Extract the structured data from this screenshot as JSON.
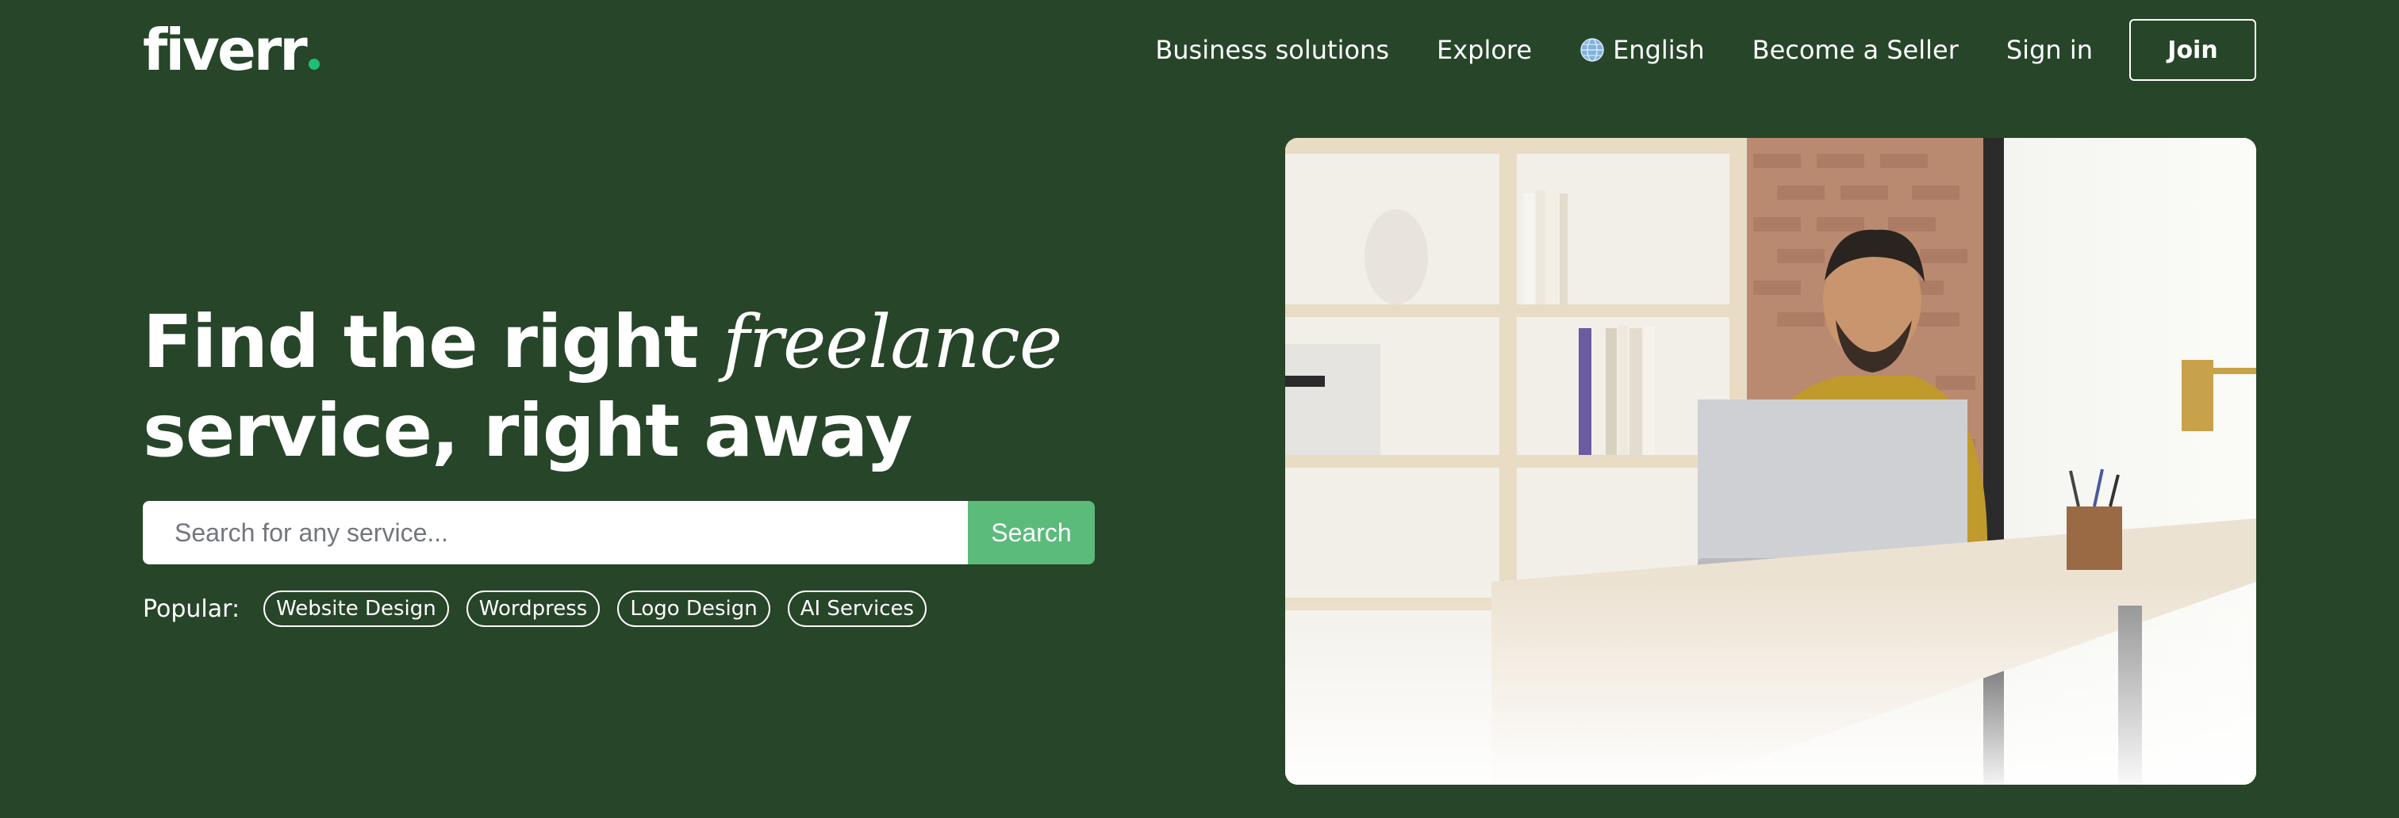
{
  "brand": {
    "logo_text": "fiverr",
    "accent": "#1dbf73",
    "background": "#274529"
  },
  "nav": {
    "items": [
      {
        "label": "Business solutions"
      },
      {
        "label": "Explore"
      },
      {
        "label": "English",
        "icon": "globe-icon"
      },
      {
        "label": "Become a Seller"
      },
      {
        "label": "Sign in"
      }
    ],
    "join_label": "Join"
  },
  "hero": {
    "title_line1_prefix": "Find the right ",
    "title_line1_emphasis": "freelance",
    "title_line2": "service, right away"
  },
  "search": {
    "placeholder": "Search for any service...",
    "value": "",
    "button_label": "Search",
    "button_color": "#5bbb7b"
  },
  "popular": {
    "label": "Popular:",
    "tags": [
      {
        "label": "Website Design"
      },
      {
        "label": "Wordpress"
      },
      {
        "label": "Logo Design"
      },
      {
        "label": "AI Services"
      }
    ]
  }
}
